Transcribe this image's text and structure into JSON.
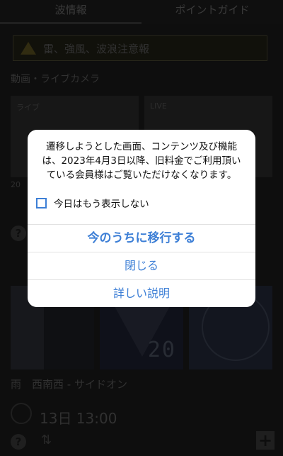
{
  "tabs": [
    "波情報",
    "ポイントガイド"
  ],
  "warning": {
    "text": "雷、強風、波浪注意報"
  },
  "section": {
    "title": "動画・ライブカメラ"
  },
  "cams": {
    "date": "20",
    "tag1": "ライブ",
    "tag2": "LIVE"
  },
  "pics": {
    "digits": "20"
  },
  "conditions": {
    "wind": "雨　西南西 - サイドオン"
  },
  "time": {
    "label": "13日 13:00"
  },
  "icons": {
    "help": "?",
    "swap": "⇅",
    "plus": "+"
  },
  "modal": {
    "message": "遷移しようとした画面、コンテンツ及び機能は、2023年4月3日以降、旧料金でご利用頂いている会員様はご覧いただけなくなります。",
    "checkbox_label": "今日はもう表示しない",
    "primary_label": "今のうちに移行する",
    "close_label": "閉じる",
    "detail_label": "詳しい説明"
  },
  "colors": {
    "accent": "#3d7fd6",
    "background": "#1a1a1a",
    "modal_bg": "#ffffff"
  }
}
